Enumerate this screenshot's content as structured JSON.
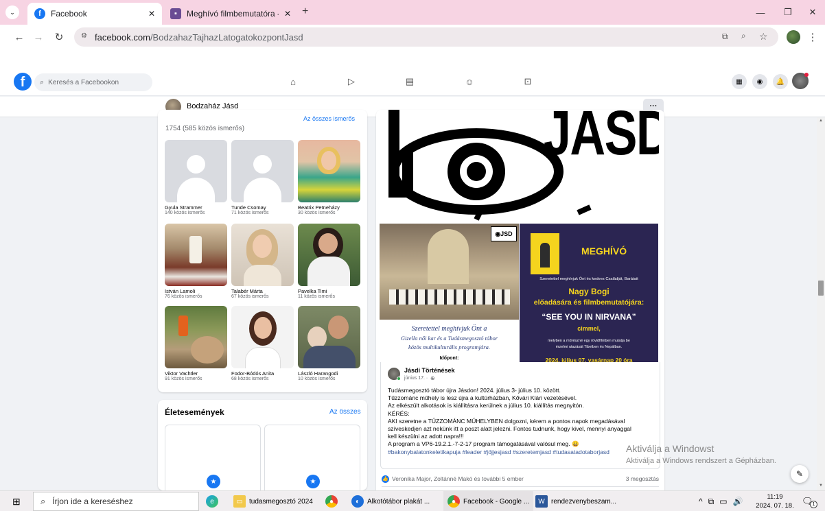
{
  "browser": {
    "tabs": [
      {
        "title": "Facebook"
      },
      {
        "title": "Meghívó filmbemutatóra - Jásd"
      }
    ],
    "url_host": "facebook.com",
    "url_path": "/BodzahazTajhazLatogatokozpontJasd"
  },
  "facebook": {
    "search_placeholder": "Keresés a Facebookon",
    "profile_name": "Bodzaház Jásd",
    "more_label": "···"
  },
  "friends": {
    "count_text": "1754 (585 közös ismerős)",
    "see_all": "Az összes ismerős",
    "items": [
      {
        "name": "Gyula Strammer",
        "mutual": "140 közös ismerős"
      },
      {
        "name": "Tunde Csomay",
        "mutual": "71 közös ismerős"
      },
      {
        "name": "Beatrix Petneházy",
        "mutual": "30 közös ismerős"
      },
      {
        "name": "István Lamoli",
        "mutual": "76 közös ismerős"
      },
      {
        "name": "Talabér Márta",
        "mutual": "67 közös ismerős"
      },
      {
        "name": "Pavelka Timi",
        "mutual": "11 közös ismerős"
      },
      {
        "name": "Viktor Vachtler",
        "mutual": "91 közös ismerős"
      },
      {
        "name": "Fodor-Bódós Anita",
        "mutual": "68 közös ismerős"
      },
      {
        "name": "László Harangodi",
        "mutual": "10 közös ismerős"
      }
    ]
  },
  "life_events": {
    "title": "Életesemények",
    "see_all": "Az összes"
  },
  "post": {
    "logo_text": "JASD",
    "choir_caption_1": "Szeretettel meghívjuk Önt a",
    "choir_caption_2": "Gizella női kar és a Tudásmegosztó tábor",
    "choir_caption_3": "közös multikulturális programjára.",
    "choir_caption_4": "Időpont:",
    "invite_title": "MEGHÍVÓ",
    "invite_line1": "Szeretettel meghívjuk Önt és kedves Családját, Barátait",
    "invite_name": "Nagy Bogi",
    "invite_line2": "előadására és filmbemutatójára:",
    "invite_film": "“SEE YOU IN NIRVANA”",
    "invite_cimmel": "cimmel,",
    "invite_desc1": "melyben a műrészné egy rövidfilmben mutatja be",
    "invite_desc2": "érzelmi utazását Tibetben és Nepálban.",
    "invite_date": "2024. július 07. vasárnap 20 óra",
    "author": "Jásdi Történések",
    "date": "június 17. ·",
    "lines": [
      "Tudásmegosztó tábor újra Jásdon! 2024. július 3- július 10. között.",
      "Tűzzománc műhely is lesz újra a kultúrházban, Kővári Klári vezetésével.",
      "Az elkészült alkotások is kiállításra kerülnek a július 10. kiállítás megnyitón.",
      "KÉRÉS:",
      "AKI szeretne a TŰZZOMÁNC MŰHELYBEN dolgozni, kérem a pontos napok megadásával",
      "szíveskedjen azt nekünk itt a poszt alatt jelezni. Fontos tudnunk, hogy kivel, mennyi anyaggal",
      "kell készülni az adott napra!!!",
      "A program a VP6-19.2.1.-7-2-17 program támogatásával valósul meg. 😀"
    ],
    "hashtags": "#bakonybalatonkeletikapuja #leader #jöjjesjasd #szeretemjasd #tudasatadotaborjasd",
    "reactions": "Veronika Major, Zoltánné Makó és további 5 ember",
    "shares": "3 megosztás"
  },
  "watermark": {
    "title": "Aktiválja a Windowst",
    "subtitle": "Aktiválja a Windows rendszert a Gépházban."
  },
  "taskbar": {
    "search_placeholder": "Írjon ide a kereséshez",
    "apps": [
      {
        "label": "tudasmegosztó 2024"
      },
      {
        "label": "Alkotótábor plakát ..."
      },
      {
        "label": "Facebook - Google ..."
      },
      {
        "label": "rendezvenybeszam..."
      }
    ],
    "time": "11:19",
    "date": "2024. 07. 18.",
    "notif_count": "1"
  },
  "colors": {
    "fb_blue": "#1877f2",
    "tab_bg": "#f7d4e3",
    "invite_purple": "#2b2552",
    "invite_yellow": "#f5d41e"
  }
}
